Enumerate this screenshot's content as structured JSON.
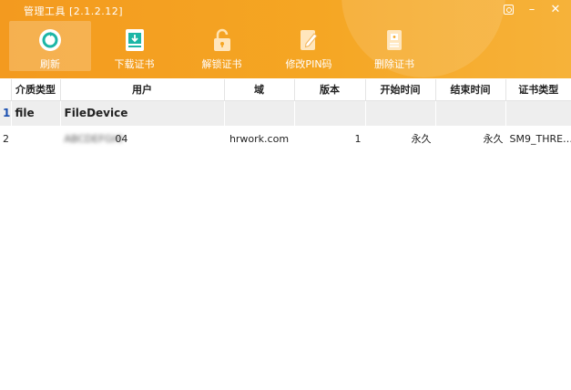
{
  "window": {
    "title": "管理工具 [2.1.2.12]",
    "buttons": [
      "skin-icon",
      "minimize-icon",
      "close-icon"
    ]
  },
  "toolbar": {
    "items": [
      {
        "label": "刷新",
        "icon": "refresh-icon",
        "active": true
      },
      {
        "label": "下载证书",
        "icon": "download-cert-icon",
        "active": false
      },
      {
        "label": "解锁证书",
        "icon": "unlock-icon",
        "active": false
      },
      {
        "label": "修改PIN码",
        "icon": "edit-pin-icon",
        "active": false
      },
      {
        "label": "删除证书",
        "icon": "delete-cert-icon",
        "active": false
      }
    ]
  },
  "table": {
    "columns": [
      "介质类型",
      "用户",
      "域",
      "版本",
      "开始时间",
      "结束时间",
      "证书类型"
    ],
    "rows": [
      {
        "index": "1",
        "cells": [
          "file",
          "FileDevice",
          "",
          "",
          "",
          "",
          ""
        ]
      },
      {
        "index": "2",
        "cells": [
          "",
          "                04",
          "hrwork.com",
          "1",
          "永久",
          "永久",
          "SM9_THRE…"
        ]
      }
    ]
  },
  "colors": {
    "header_orange": "#f5a623",
    "selected_row": "#eeeeee",
    "row_index_blue": "#1a4fb0"
  }
}
